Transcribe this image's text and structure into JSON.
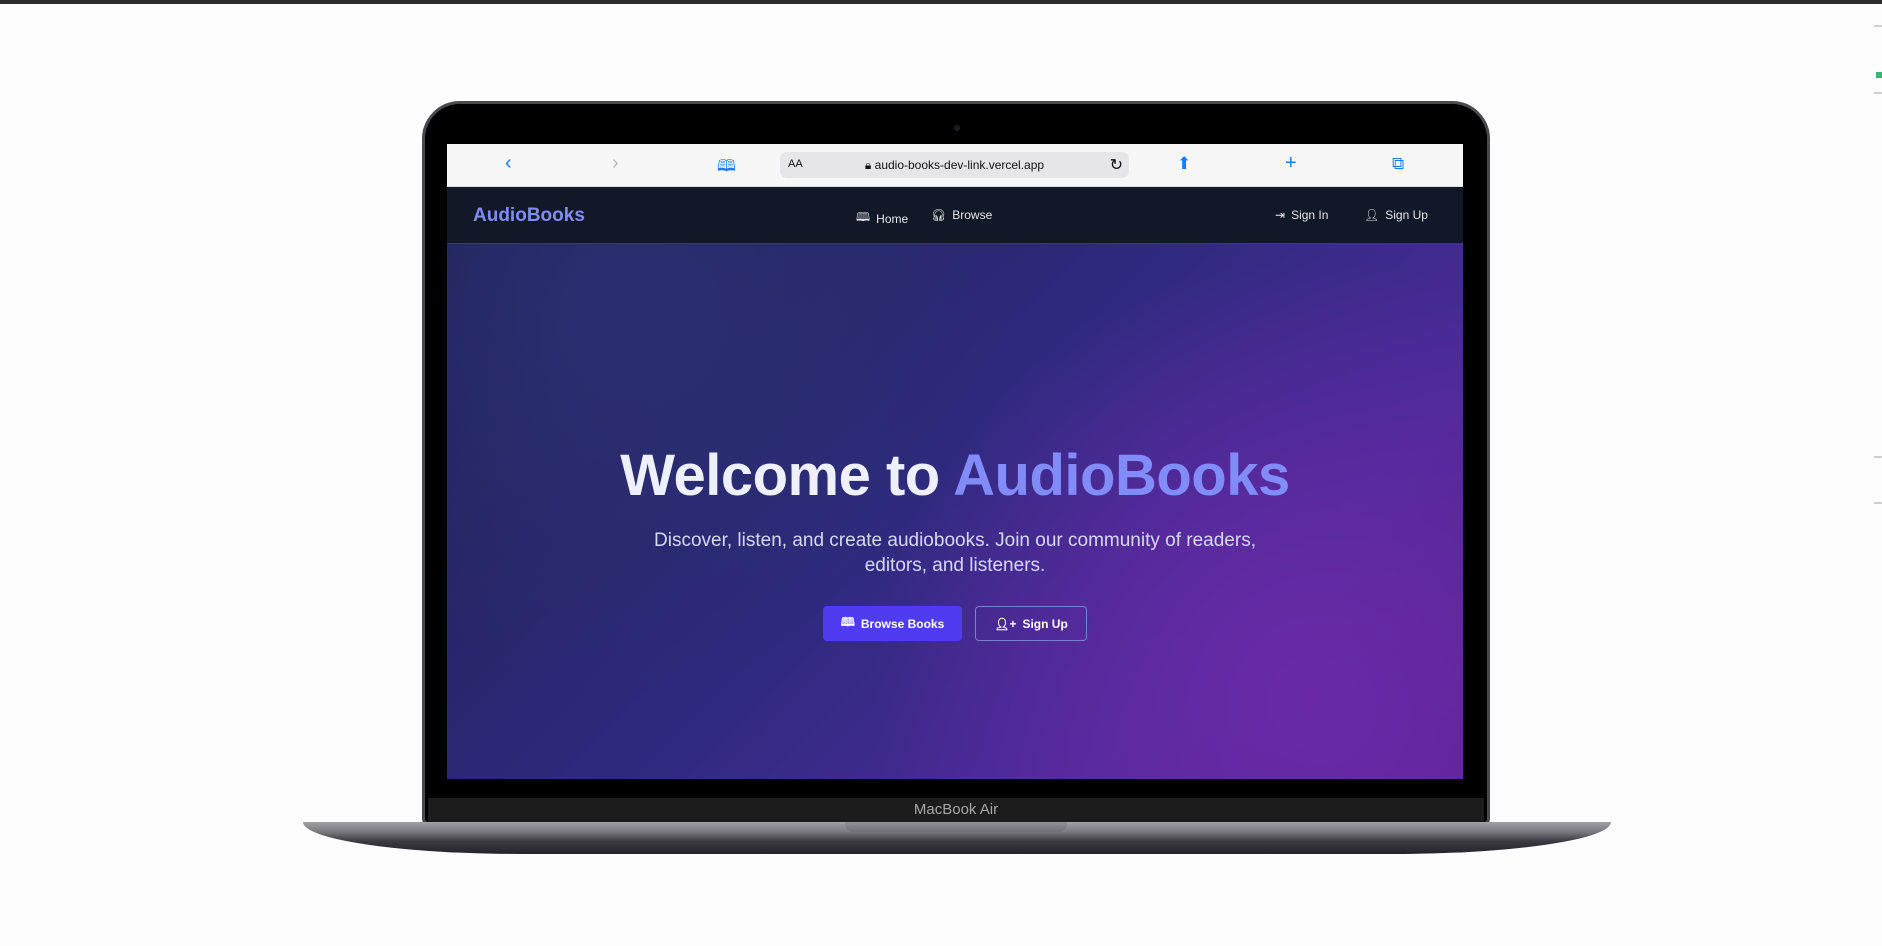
{
  "browser": {
    "text_size": "AA",
    "url": "audio-books-dev-link.vercel.app"
  },
  "nav": {
    "logo": "AudioBooks",
    "home": "Home",
    "browse": "Browse",
    "sign_in": "Sign In",
    "sign_up": "Sign Up"
  },
  "hero": {
    "title_prefix": "Welcome to ",
    "title_accent": "AudioBooks",
    "subtitle": "Discover, listen, and create audiobooks. Join our community of readers, editors, and listeners.",
    "browse_button": "Browse Books",
    "signup_button": "Sign Up"
  },
  "device": {
    "label": "MacBook Air"
  },
  "colors": {
    "accent": "#818cf8",
    "primary_button": "#4f3cf0",
    "nav_bg": "#111827"
  }
}
